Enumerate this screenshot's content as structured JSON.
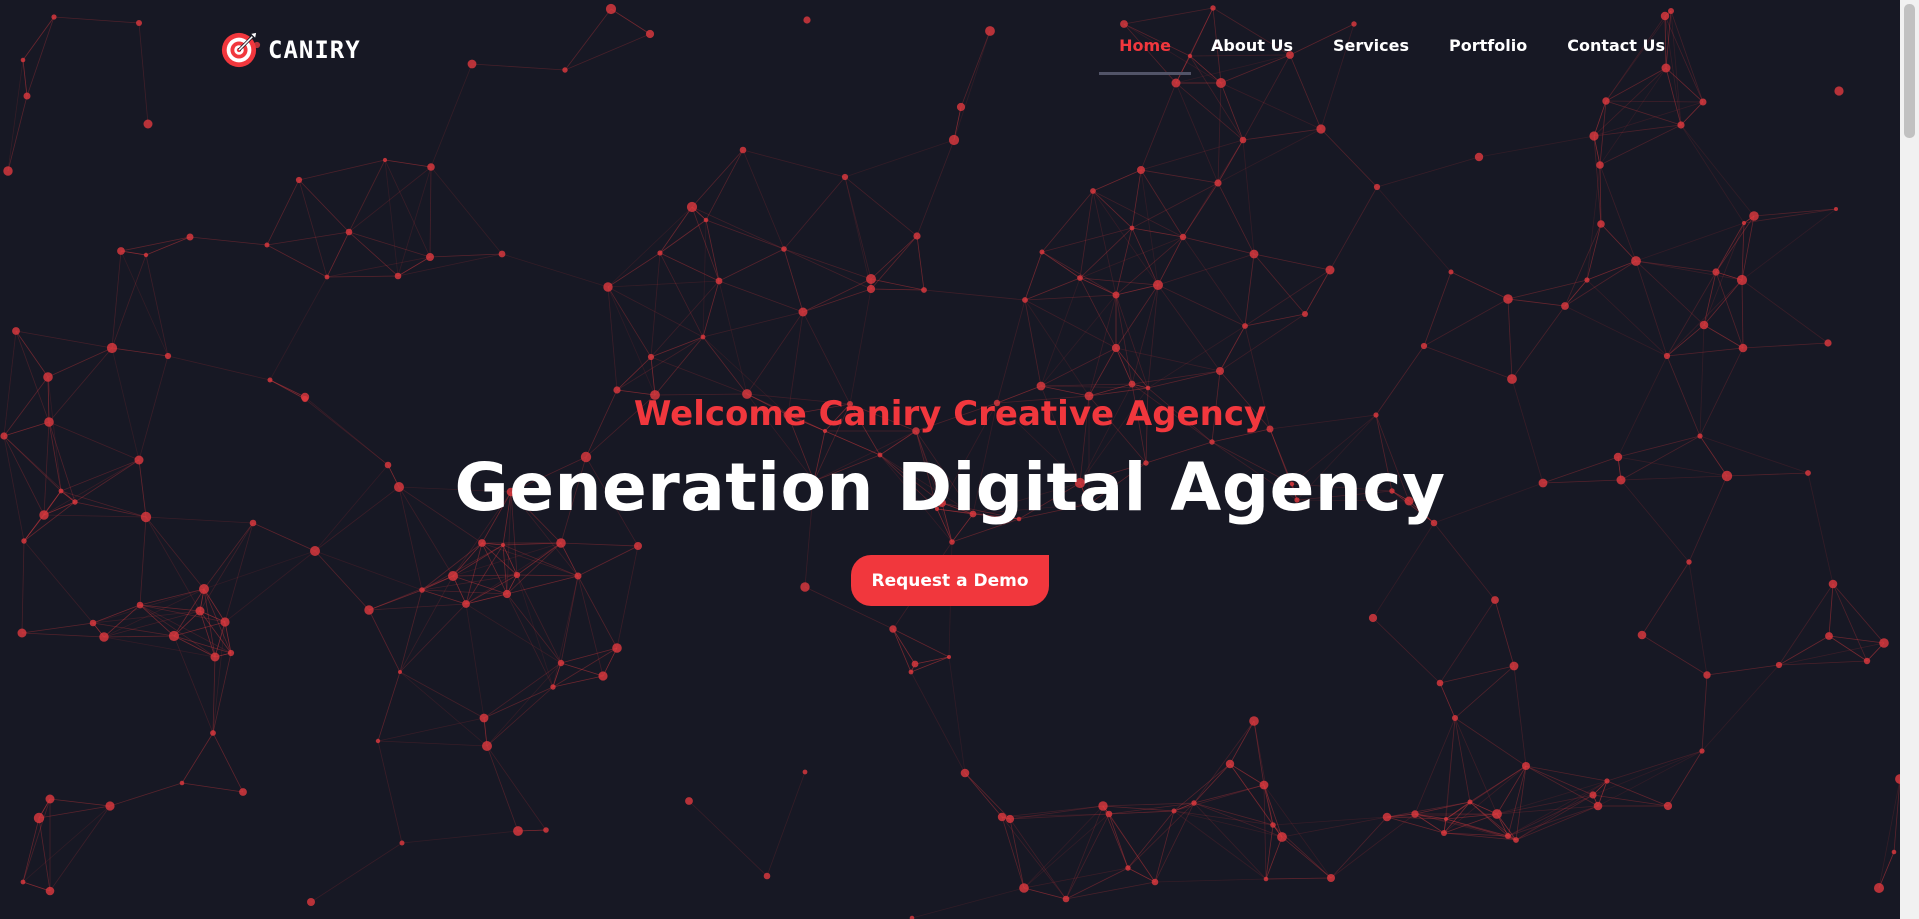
{
  "brand": {
    "name": "CANIRY",
    "logo_icon": "target-icon",
    "accent_color": "#f1373d",
    "background_color": "#171824"
  },
  "nav": {
    "items": [
      {
        "label": "Home",
        "active": true
      },
      {
        "label": "About Us",
        "active": false
      },
      {
        "label": "Services",
        "active": false
      },
      {
        "label": "Portfolio",
        "active": false
      },
      {
        "label": "Contact Us",
        "active": false
      }
    ]
  },
  "hero": {
    "subtitle": "Welcome Caniry Creative Agency",
    "title": "Generation Digital Agency",
    "button_label": "Request a Demo"
  },
  "background": {
    "pattern": "particle-network",
    "node_color": "#e03a3f"
  }
}
